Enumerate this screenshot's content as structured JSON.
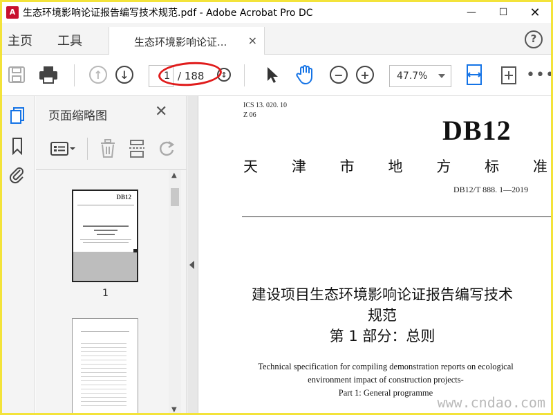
{
  "window": {
    "title": "生态环境影响论证报告编写技术规范.pdf - Adobe Acrobat Pro DC",
    "minimize": "—",
    "maximize": "☐"
  },
  "menu": {
    "home": "主页",
    "tools": "工具",
    "doc_tab": "生态环境影响论证...",
    "doc_tab_close": "×",
    "help": "?"
  },
  "toolbar": {
    "page_current": "1",
    "page_total": "/ 188",
    "zoom": "47.7%",
    "more": "•••"
  },
  "thumbnails_panel": {
    "title": "页面缩略图",
    "close": "✕",
    "page_labels": [
      "1"
    ]
  },
  "document": {
    "ics": "ICS 13. 020. 10",
    "z_code": "Z 06",
    "code": "DB12",
    "issuer_chars": [
      "天",
      "津",
      "市",
      "地",
      "方",
      "标",
      "准"
    ],
    "std_number": "DB12/T 888. 1—2019",
    "title_cn_line1": "建设项目生态环境影响论证报告编写技术",
    "title_cn_line2": "规范",
    "part_cn": "第 1 部分：总则",
    "title_en_line1": "Technical specification for compiling demonstration reports on ecological",
    "title_en_line2": "environment impact of construction projects-",
    "title_en_line3": "Part 1: General programme"
  },
  "watermark": "www.cndao.com",
  "colors": {
    "acrobat_blue": "#1473e6",
    "annotation_red": "#e01b1b",
    "frame_yellow": "#f3e33a"
  }
}
